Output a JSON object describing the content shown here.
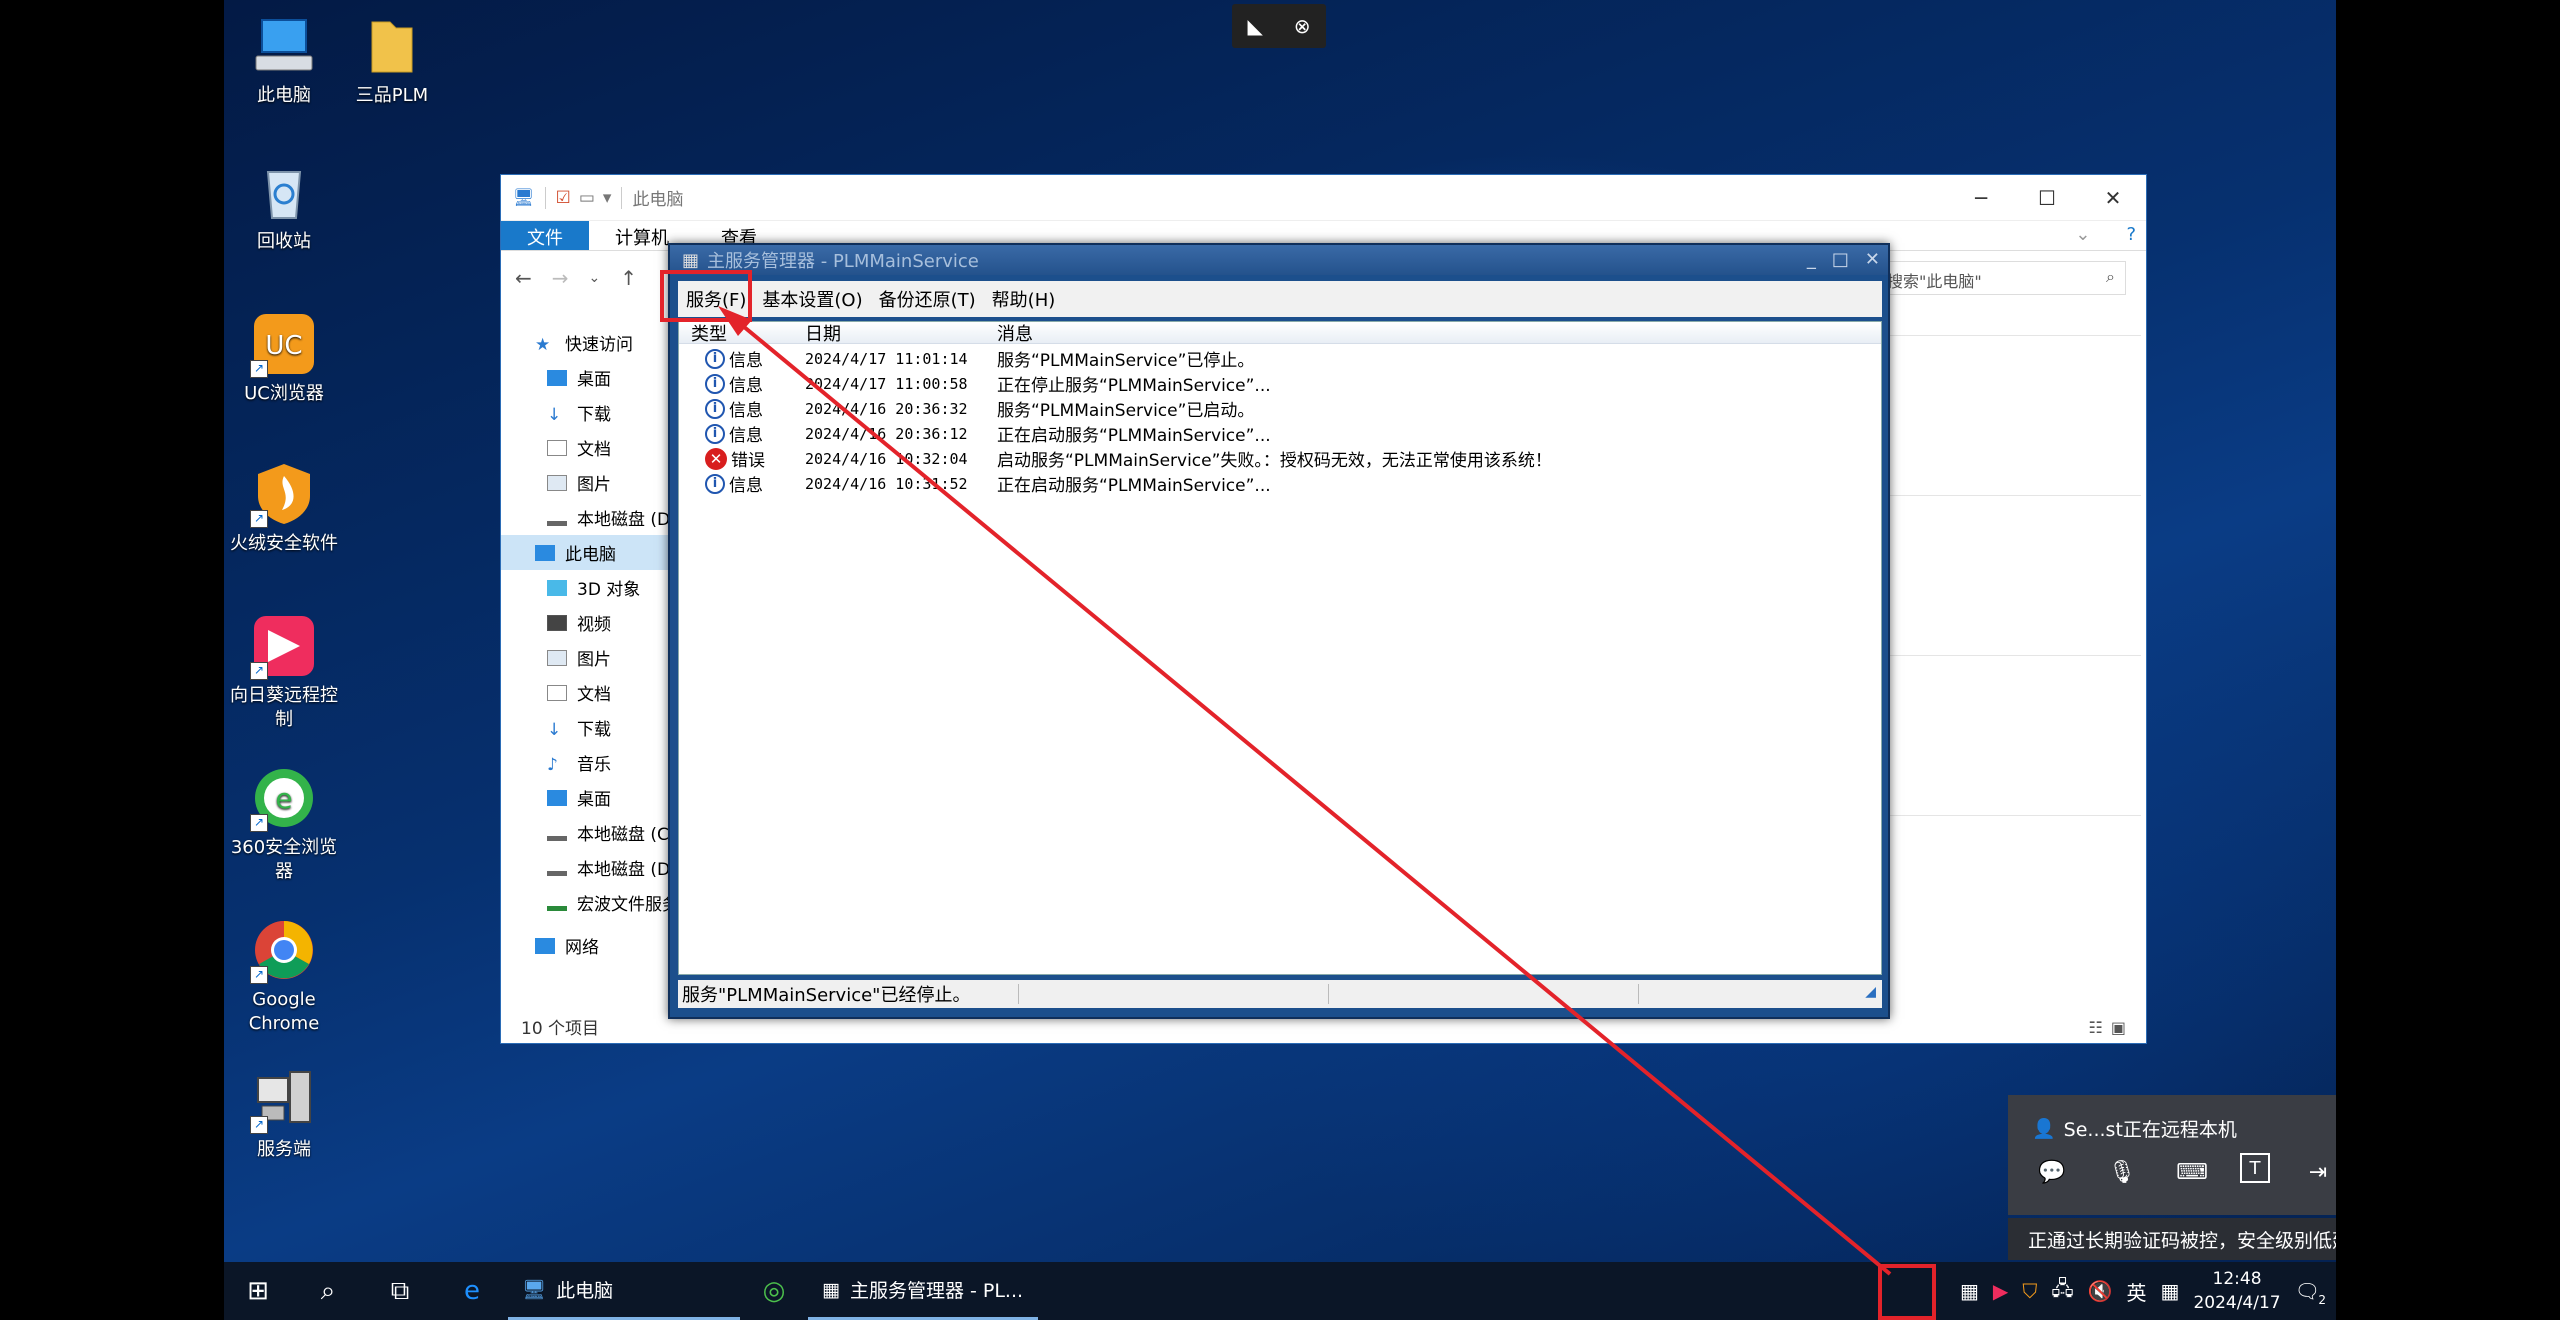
{
  "remote_topbar": {
    "pin_icon": "pin-icon",
    "close_icon": "close-icon"
  },
  "desktop": {
    "icons": [
      {
        "label": "此电脑"
      },
      {
        "label": "三品PLM"
      },
      {
        "label": "回收站"
      },
      {
        "label": "UC浏览器"
      },
      {
        "label": "火绒安全软件"
      },
      {
        "label": "向日葵远程控制"
      },
      {
        "label": "360安全浏览器"
      },
      {
        "label": "Google Chrome"
      },
      {
        "label": "服务端"
      }
    ]
  },
  "explorer": {
    "title": "此电脑",
    "ribbon": {
      "file": "文件",
      "computer": "计算机",
      "view": "查看"
    },
    "search_placeholder": "搜索\"此电脑\"",
    "nav": [
      "快速访问",
      "桌面",
      "下载",
      "文档",
      "图片",
      "本地磁盘 (D:)",
      "此电脑",
      "3D 对象",
      "视频",
      "图片",
      "文档",
      "下载",
      "音乐",
      "桌面",
      "本地磁盘 (C:)",
      "本地磁盘 (D:)",
      "宏波文件服务器",
      "网络"
    ],
    "status": "10 个项目"
  },
  "service_manager": {
    "title": "主服务管理器 - PLMMainService",
    "menu": {
      "service": "服务(F)",
      "settings": "基本设置(O)",
      "backup": "备份还原(T)",
      "help": "帮助(H)"
    },
    "columns": {
      "type": "类型",
      "date": "日期",
      "message": "消息"
    },
    "log": [
      {
        "type": "信息",
        "level": "info",
        "date": "2024/4/17 11:01:14",
        "message": "服务“PLMMainService”已停止。"
      },
      {
        "type": "信息",
        "level": "info",
        "date": "2024/4/17 11:00:58",
        "message": "正在停止服务“PLMMainService”..."
      },
      {
        "type": "信息",
        "level": "info",
        "date": "2024/4/16 20:36:32",
        "message": "服务“PLMMainService”已启动。"
      },
      {
        "type": "信息",
        "level": "info",
        "date": "2024/4/16 20:36:12",
        "message": "正在启动服务“PLMMainService”..."
      },
      {
        "type": "错误",
        "level": "error",
        "date": "2024/4/16 10:32:04",
        "message": "启动服务“PLMMainService”失败。：授权码无效，无法正常使用该系统！"
      },
      {
        "type": "信息",
        "level": "info",
        "date": "2024/4/16 10:31:52",
        "message": "正在启动服务“PLMMainService”..."
      }
    ],
    "status": "服务\"PLMMainService\"已经停止。"
  },
  "remote_panel": {
    "session_text": "Se...st正在远程本机",
    "tools": [
      "chat-icon",
      "microphone-icon",
      "keyboard-icon",
      "text-icon",
      "file-transfer-icon",
      "disconnect-icon"
    ],
    "notice": "正通过长期验证码被控，安全级别低建议改为今日验证码"
  },
  "taskbar": {
    "apps": [
      {
        "label": "此电脑"
      },
      {
        "label": "主服务管理器 - PL..."
      }
    ],
    "tray": {
      "ime": "英"
    },
    "clock": {
      "time": "12:48",
      "date": "2024/4/17"
    },
    "notification_count": "2"
  },
  "annotation": {
    "color": "#e3232a"
  }
}
